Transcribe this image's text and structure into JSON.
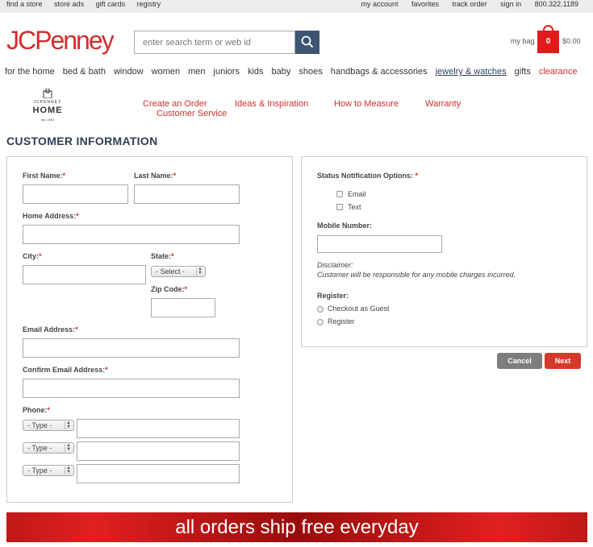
{
  "topbar": {
    "left_links": [
      "find a store",
      "store ads",
      "gift cards",
      "registry"
    ],
    "right_links": [
      "my account",
      "favorites",
      "track order",
      "sign in"
    ],
    "phone": "800.322.1189"
  },
  "header": {
    "logo_text": "JCPenney",
    "search_placeholder": "enter search term or web id",
    "bag_label": "my bag",
    "bag_count": "0",
    "bag_total": "$0.00"
  },
  "nav": {
    "items": [
      "for the home",
      "bed & bath",
      "window",
      "women",
      "men",
      "juniors",
      "kids",
      "baby",
      "shoes",
      "handbags & accessories",
      "jewelry & watches",
      "gifts",
      "clearance"
    ]
  },
  "subheader": {
    "logo_small": "JCPENNEY",
    "logo_big": "HOME",
    "logo_est": "est. 1902",
    "links": [
      "Create an Order",
      "Ideas & Inspiration",
      "How to Measure",
      "Warranty",
      "Customer Service"
    ]
  },
  "page_title": "CUSTOMER INFORMATION",
  "form": {
    "first_name": "First Name:",
    "last_name": "Last Name:",
    "home_address": "Home Address:",
    "city": "City:",
    "state": "State:",
    "state_select": "- Select -",
    "zip": "Zip Code:",
    "email": "Email Address:",
    "confirm_email": "Confirm Email Address:",
    "phone": "Phone:",
    "phone_type": "- Type -",
    "required_mark": "*"
  },
  "notifications": {
    "label": "Status Notification Options:",
    "options": [
      "Email",
      "Text"
    ],
    "mobile_label": "Mobile Number:",
    "disclaimer_title": "Disclaimer:",
    "disclaimer_text": "Customer will be responsible for any mobile charges incurred.",
    "register_label": "Register:",
    "register_options": [
      "Checkout as Guest",
      "Register"
    ]
  },
  "buttons": {
    "cancel": "Cancel",
    "next": "Next"
  },
  "banner": "all orders ship free everyday",
  "colors": {
    "brand_red": "#d22e2e",
    "navy": "#2f3e54",
    "search_button": "#3d5572"
  }
}
